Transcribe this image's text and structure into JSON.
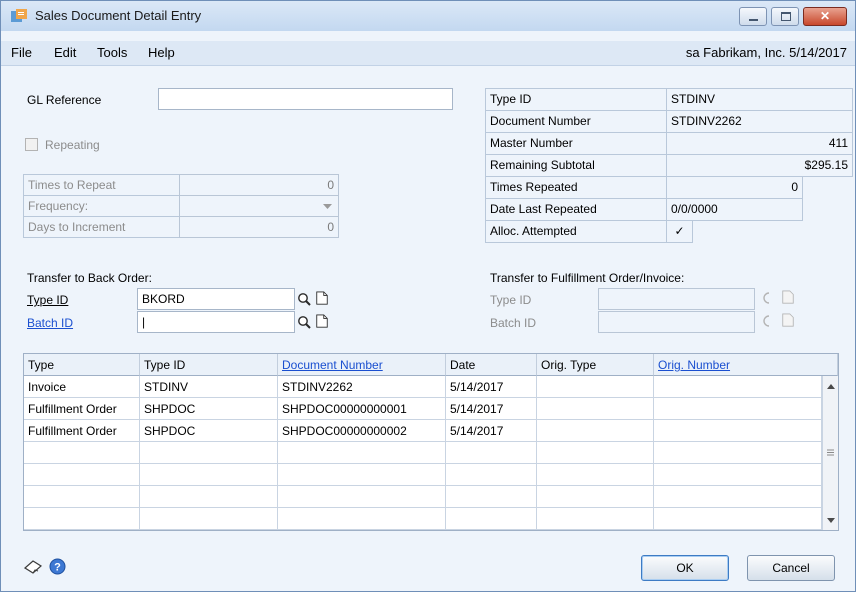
{
  "window": {
    "title": "Sales Document Detail Entry",
    "close_label": "✕"
  },
  "menu": {
    "items": [
      "File",
      "Edit",
      "Tools",
      "Help"
    ],
    "company_info": "sa  Fabrikam, Inc.  5/14/2017"
  },
  "left": {
    "gl_reference_label": "GL Reference",
    "gl_reference_value": "",
    "repeating_label": "Repeating",
    "repeating_checked": false,
    "times_to_repeat_label": "Times to Repeat",
    "times_to_repeat_value": "0",
    "frequency_label": "Frequency:",
    "frequency_value": "",
    "days_to_increment_label": "Days to Increment",
    "days_to_increment_value": "0"
  },
  "right": {
    "type_id_label": "Type ID",
    "type_id_value": "STDINV",
    "document_number_label": "Document Number",
    "document_number_value": "STDINV2262",
    "master_number_label": "Master Number",
    "master_number_value": "411",
    "remaining_subtotal_label": "Remaining Subtotal",
    "remaining_subtotal_value": "$295.15",
    "times_repeated_label": "Times Repeated",
    "times_repeated_value": "0",
    "date_last_repeated_label": "Date Last Repeated",
    "date_last_repeated_value": "0/0/0000",
    "alloc_attempted_label": "Alloc. Attempted",
    "alloc_attempted_value": "✓"
  },
  "back_order": {
    "heading": "Transfer to Back Order:",
    "type_id_label": "Type ID",
    "type_id_value": "BKORD",
    "batch_id_label": "Batch ID",
    "batch_id_value": "|"
  },
  "fulfillment": {
    "heading": "Transfer to Fulfillment Order/Invoice:",
    "type_id_label": "Type ID",
    "type_id_value": "",
    "batch_id_label": "Batch ID",
    "batch_id_value": ""
  },
  "grid": {
    "columns": [
      "Type",
      "Type ID",
      "Document Number",
      "Date",
      "Orig. Type",
      "Orig. Number"
    ],
    "rows": [
      [
        "Invoice",
        "STDINV",
        "STDINV2262",
        "5/14/2017",
        "",
        ""
      ],
      [
        "Fulfillment Order",
        "SHPDOC",
        "SHPDOC00000000001",
        "5/14/2017",
        "",
        ""
      ],
      [
        "Fulfillment Order",
        "SHPDOC",
        "SHPDOC00000000002",
        "5/14/2017",
        "",
        ""
      ],
      [
        "",
        "",
        "",
        "",
        "",
        ""
      ],
      [
        "",
        "",
        "",
        "",
        "",
        ""
      ],
      [
        "",
        "",
        "",
        "",
        "",
        ""
      ],
      [
        "",
        "",
        "",
        "",
        "",
        ""
      ]
    ]
  },
  "buttons": {
    "ok": "OK",
    "cancel": "Cancel"
  }
}
